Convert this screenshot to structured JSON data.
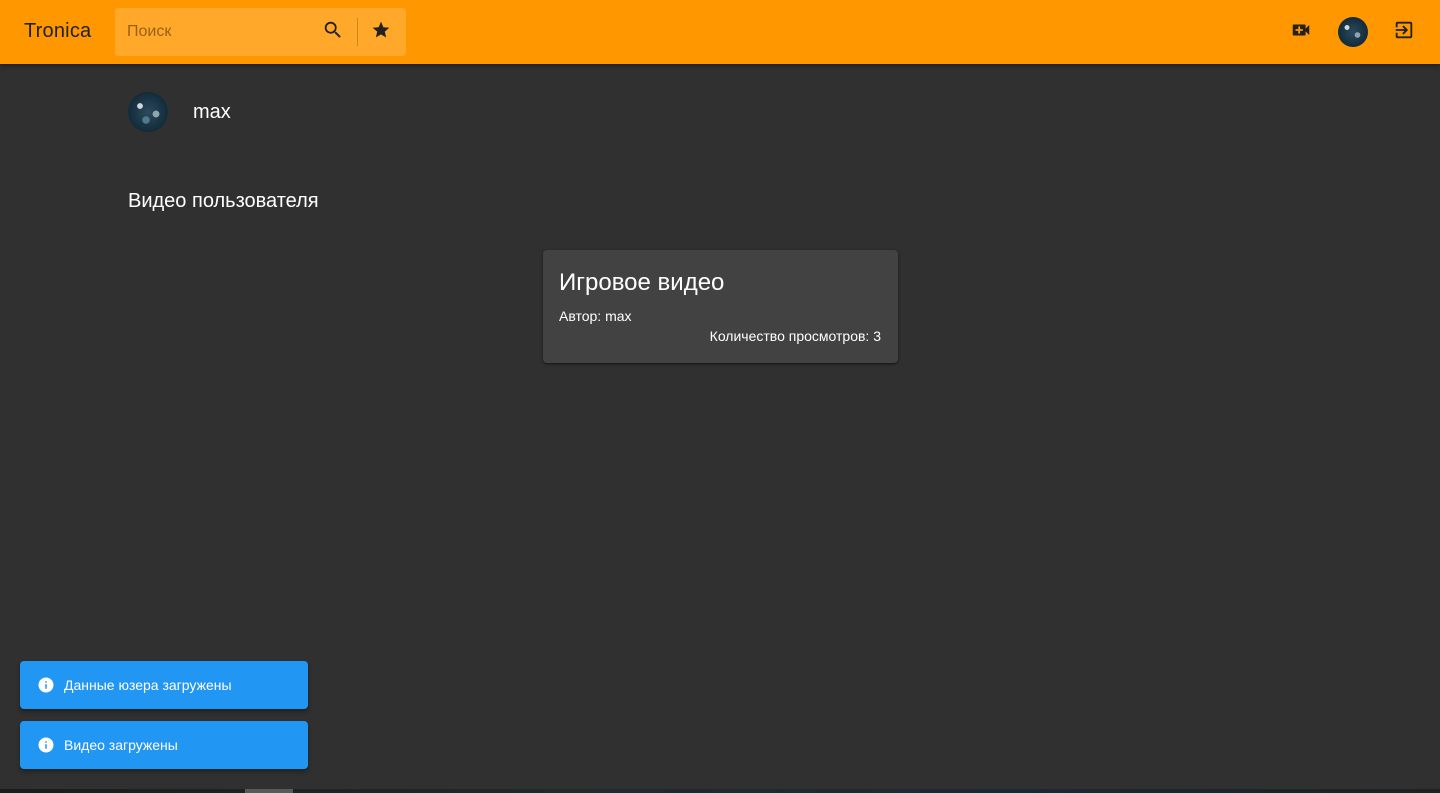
{
  "header": {
    "brand": "Tronica",
    "search_placeholder": "Поиск",
    "search_value": "",
    "icons": {
      "search": "search-icon",
      "favorites": "star-icon",
      "add_video": "video-add-icon",
      "avatar": "user-avatar",
      "logout": "logout-icon"
    },
    "color": "#ff9800"
  },
  "profile": {
    "username": "max"
  },
  "section": {
    "title": "Видео пользователя"
  },
  "videos": [
    {
      "title": "Игровое видео",
      "author": "Автор: max",
      "views": "Количество просмотров: 3"
    }
  ],
  "notifications": [
    {
      "text": "Данные юзера загружены",
      "icon": "info-icon"
    },
    {
      "text": "Видео загружены",
      "icon": "info-icon"
    }
  ],
  "colors": {
    "background": "#303030",
    "card": "#424242",
    "snackbar": "#2196f3",
    "accent": "#ff9800"
  }
}
